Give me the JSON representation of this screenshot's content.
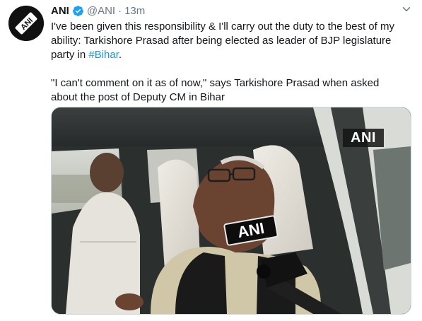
{
  "tweet": {
    "author_name": "ANI",
    "handle": "@ANI",
    "separator": "·",
    "time": "13m",
    "paragraph1_text": "I've been given this responsibility & I'll carry out the duty to the best of my ability: Tarkishore Prasad after being elected as leader of BJP legislature party in ",
    "paragraph1_hashtag": "#Bihar",
    "paragraph1_end": ".",
    "paragraph2": "\"I can't comment on it as of now,\" says Tarkishore Prasad when asked about the post of Deputy CM in Bihar",
    "media": {
      "watermark": "ANI",
      "mic_label": "ANI"
    },
    "avatar_logo": "ANI"
  },
  "colors": {
    "text": "#14171a",
    "secondary": "#657786",
    "link": "#1b95e0",
    "verified": "#1da1f2"
  },
  "icons": [
    "verified-badge-icon",
    "chevron-down-icon"
  ]
}
